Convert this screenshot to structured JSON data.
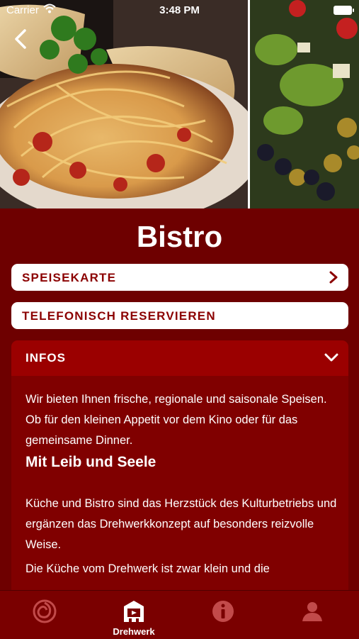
{
  "status_bar": {
    "carrier": "Carrier",
    "time": "3:48 PM"
  },
  "page": {
    "title": "Bistro"
  },
  "buttons": {
    "menu": "SPEISEKARTE",
    "reserve": "TELEFONISCH RESERVIEREN"
  },
  "infos": {
    "header": "INFOS",
    "intro": "Wir bieten Ihnen frische, regionale und saisonale Speisen. Ob für den kleinen Appetit vor dem Kino oder für das gemeinsame Dinner.",
    "subheading": "Mit Leib und Seele",
    "body": "Küche und Bistro sind das Herzstück des Kulturbetriebs und ergänzen das Drehwerkkonzept auf besonders reizvolle Weise.",
    "body2": "Die Küche vom Drehwerk ist zwar klein und die"
  },
  "tabbar": {
    "items": [
      {
        "icon": "spiral-logo-icon",
        "label": ""
      },
      {
        "icon": "drehwerk-building-icon",
        "label": "Drehwerk"
      },
      {
        "icon": "info-icon",
        "label": ""
      },
      {
        "icon": "user-profile-icon",
        "label": ""
      }
    ]
  },
  "colors": {
    "brand": "#6e0000",
    "accent": "#8b0000",
    "header": "#9b0000"
  }
}
